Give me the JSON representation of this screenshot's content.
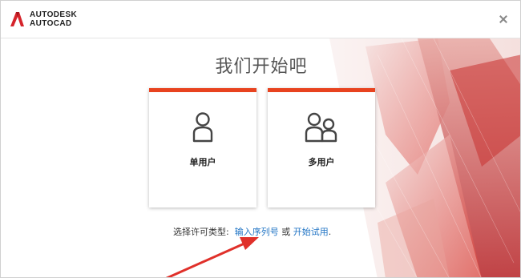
{
  "brand": {
    "line1": "AUTODESK",
    "line2": "AUTOCAD",
    "accent": "#e8431f"
  },
  "window": {
    "close_icon": "close-icon"
  },
  "main": {
    "title": "我们开始吧",
    "cards": [
      {
        "label": "单用户",
        "icon": "single-user-icon"
      },
      {
        "label": "多用户",
        "icon": "multi-user-icon"
      }
    ],
    "choose_text": "选择许可类型:",
    "serial_link": "输入序列号",
    "or_text": "或",
    "trial_link": "开始试用",
    "period": "."
  },
  "colors": {
    "link": "#1f73c4",
    "annotation_arrow": "#e0302a"
  }
}
